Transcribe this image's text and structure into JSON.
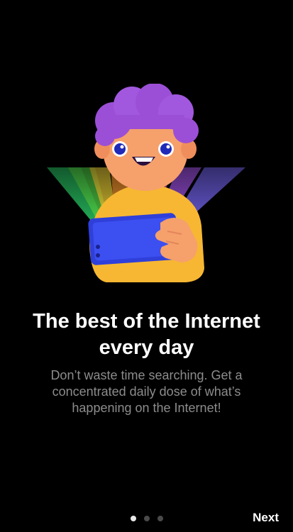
{
  "onboarding": {
    "headline_line1": "The best of the Internet",
    "headline_line2": "every day",
    "description": "Don’t waste time searching. Get a concentrated daily dose of what’s happening on the Internet!",
    "illustration_icon": "person-with-phone-rainbow-illustration",
    "pager": {
      "total_pages": 3,
      "current_page": 1
    },
    "next_label": "Next"
  },
  "colors": {
    "background": "#000000",
    "headline": "#ffffff",
    "description": "#8c8c8c",
    "dot_active": "#e8e8e8",
    "dot_inactive": "#4a4a4a",
    "hair": "#9b4fd6",
    "skin": "#f6a06c",
    "shirt": "#f7b733",
    "phone": "#2f3fd9"
  }
}
